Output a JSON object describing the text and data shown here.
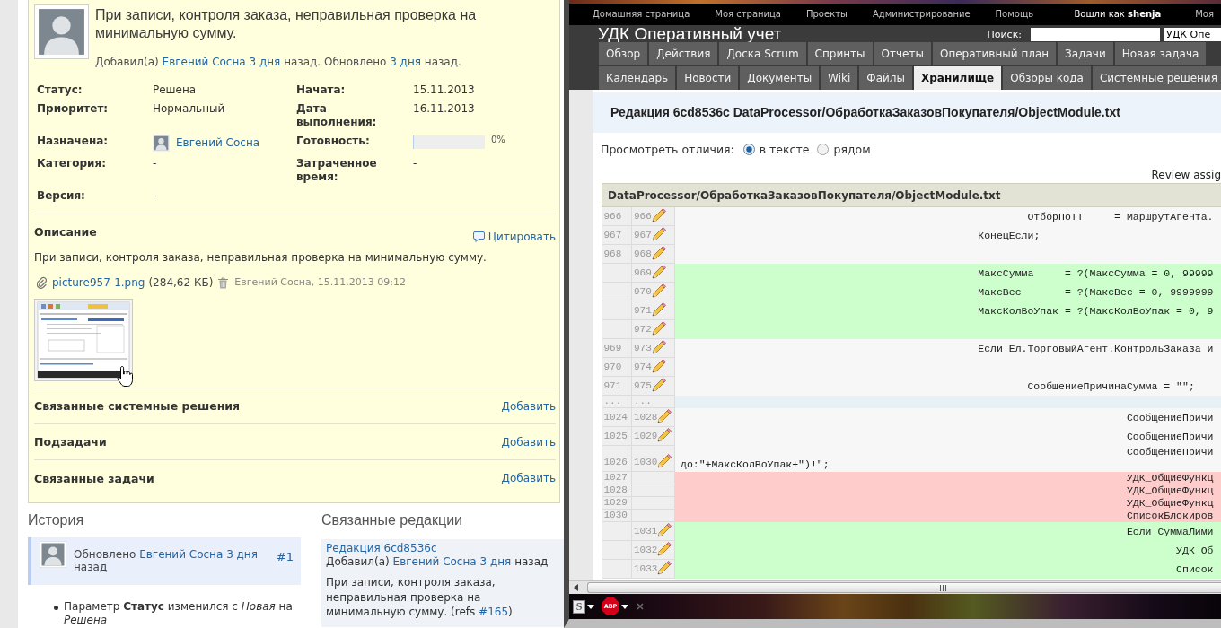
{
  "issue": {
    "subject": "При записи, контроля заказа, неправильная проверка на минимальную сумму.",
    "byline": [
      {
        "kind": "text",
        "text": "Добавил(а) "
      },
      {
        "kind": "user",
        "text": "Евгений Сосна"
      },
      {
        "kind": "time",
        "text": "3 дня"
      },
      {
        "kind": "text",
        "text": " назад. Обновлено "
      },
      {
        "kind": "time",
        "text": "3 дня"
      },
      {
        "kind": "text",
        "text": " назад."
      }
    ],
    "attributes": [
      {
        "left": {
          "label": "Статус:",
          "kind": "text",
          "value": "Решена"
        },
        "right": {
          "label": "Начата:",
          "kind": "text",
          "value": "15.11.2013"
        }
      },
      {
        "left": {
          "label": "Приоритет:",
          "kind": "text",
          "value": "Нормальный"
        },
        "right": {
          "label": "Дата выполнения:",
          "kind": "text",
          "value": "16.11.2013"
        }
      },
      {
        "left": {
          "label": "Назначена:",
          "kind": "user",
          "value": "Евгений Сосна"
        },
        "right": {
          "label": "Готовность:",
          "kind": "progress",
          "level": 0,
          "value": "0%"
        }
      },
      {
        "left": {
          "label": "Категория:",
          "kind": "text",
          "value": "-"
        },
        "right": {
          "label": "Затраченное время:",
          "kind": "text",
          "value": "-"
        }
      },
      {
        "left": {
          "label": "Версия:",
          "kind": "text",
          "value": "-"
        }
      }
    ],
    "description": {
      "title": "Описание",
      "quote_link": "Цитировать",
      "text": "При записи, контроля заказа, неправильная проверка на минимальную сумму."
    },
    "attachment": {
      "filename": "picture957-1.png",
      "size": "(284,62 КБ)",
      "author_date": "Евгений Сосна, 15.11.2013 09:12"
    },
    "relations": [
      {
        "title": "Связанные системные решения",
        "action": "Добавить"
      },
      {
        "title": "Подзадачи",
        "action": "Добавить"
      },
      {
        "title": "Связанные задачи",
        "action": "Добавить"
      }
    ]
  },
  "history": {
    "title": "История",
    "entries": [
      {
        "header": [
          {
            "kind": "text",
            "text": "Обновлено "
          },
          {
            "kind": "user",
            "text": "Евгений Сосна"
          },
          {
            "kind": "time",
            "text": "3 дня"
          },
          {
            "kind": "text",
            "text": " назад"
          }
        ],
        "number": "#1",
        "details": [
          "Параметр **Статус** изменился с *Новая* на *Решена*"
        ]
      }
    ]
  },
  "related_revisions": {
    "title": "Связанные редакции",
    "items": [
      {
        "revision": "Редакция 6cd8536c",
        "byline": [
          {
            "kind": "text",
            "text": "Добавил(а) "
          },
          {
            "kind": "user",
            "text": "Евгений Сосна"
          },
          {
            "kind": "time",
            "text": "3 дня"
          },
          {
            "kind": "text",
            "text": " назад"
          }
        ],
        "message": [
          {
            "kind": "text",
            "text": "При записи, контроля заказа, неправильная проверка на минимальную сумму. (refs "
          },
          {
            "kind": "ref",
            "text": "#165"
          },
          {
            "kind": "text",
            "text": ")"
          }
        ]
      }
    ]
  },
  "repository_window": {
    "top_menu": [
      "Домашняя страница",
      "Моя страница",
      "Проекты",
      "Администрирование",
      "Помощь"
    ],
    "account": {
      "logged_in": "Вошли как **shenja**",
      "menu": "Моя"
    },
    "project_title": "УДК Оперативный учет",
    "search": {
      "label": "Поиск:",
      "project": "УДК Опе"
    },
    "tab_rows": [
      [
        {
          "label": "Обзор",
          "selected": false
        },
        {
          "label": "Действия",
          "selected": false
        },
        {
          "label": "Доска Scrum",
          "selected": false
        },
        {
          "label": "Спринты",
          "selected": false
        },
        {
          "label": "Отчеты",
          "selected": false
        },
        {
          "label": "Оперативный план",
          "selected": false
        },
        {
          "label": "Задачи",
          "selected": false
        },
        {
          "label": "Новая задача",
          "selected": false
        }
      ],
      [
        {
          "label": "Календарь",
          "selected": false
        },
        {
          "label": "Новости",
          "selected": false
        },
        {
          "label": "Документы",
          "selected": false
        },
        {
          "label": "Wiki",
          "selected": false
        },
        {
          "label": "Файлы",
          "selected": false
        },
        {
          "label": "Хранилище",
          "selected": true
        },
        {
          "label": "Обзоры кода",
          "selected": false
        },
        {
          "label": "Системные решения",
          "selected": false
        }
      ]
    ],
    "revision_title": "Редакция 6cd8536c DataProcessor/ОбработкаЗаказовПокупателя/ObjectModule.txt",
    "view_diff": {
      "label": "Просмотреть отличия:",
      "options": [
        {
          "label": "в тексте",
          "selected": true
        },
        {
          "label": "рядом",
          "selected": false
        }
      ]
    },
    "review_link": "Review assig",
    "diff": {
      "file": "DataProcessor/ОбработкаЗаказовПокупателя/ObjectModule.txt",
      "rows": [
        {
          "kind": "context",
          "old": "966",
          "new": "966",
          "code": [
            "\t\t\t\t\t\t\tОтборПоТТ     = МаршрутАгента."
          ]
        },
        {
          "kind": "context",
          "old": "967",
          "new": "967",
          "code": [
            "\t\t\t\t\t\tКонецЕсли;"
          ]
        },
        {
          "kind": "context",
          "old": "968",
          "new": "968"
        },
        {
          "kind": "added",
          "new": "969",
          "code": [
            "\t\t\t\t\t\tМаксСумма     = ?(МаксСумма = 0, 99999"
          ]
        },
        {
          "kind": "added",
          "new": "970",
          "code": [
            "\t\t\t\t\t\tМаксВес       = ?(МаксВес = 0, 9999999"
          ]
        },
        {
          "kind": "added",
          "new": "971",
          "code": [
            "\t\t\t\t\t\tМаксКолВоУпак = ?(МаксКолВоУпак = 0, 9"
          ]
        },
        {
          "kind": "added",
          "new": "972"
        },
        {
          "kind": "context",
          "old": "969",
          "new": "973",
          "code": [
            "\t\t\t\t\t\tЕсли Ел.ТорговыйАгент.КонтрольЗаказа и"
          ]
        },
        {
          "kind": "context",
          "old": "970",
          "new": "974"
        },
        {
          "kind": "context",
          "old": "971",
          "new": "975",
          "code": [
            "\t\t\t\t\t\t\tСообщениеПричинаСумма = \"\";"
          ]
        },
        {
          "kind": "separator",
          "old": "...",
          "new": "..."
        },
        {
          "kind": "context",
          "old": "1024",
          "new": "1028",
          "code": [
            "\t\t\t\t\t\t\t\t\tСообщениеПричи"
          ]
        },
        {
          "kind": "context",
          "old": "1025",
          "new": "1029",
          "code": [
            "\t\t\t\t\t\t\t\t\tСообщениеПричи"
          ]
        },
        {
          "kind": "context",
          "old": "1026",
          "new": "1030",
          "code": [
            "\t\t\t\t\t\t\t\t\tСообщениеПричи",
            "до:\"+МаксКолВоУпак+\")!\";"
          ]
        },
        {
          "kind": "removed",
          "old": "1027",
          "code": [
            "\t\t\t\t\t\t\t\t\tУДК_ОбщиеФункц"
          ]
        },
        {
          "kind": "removed",
          "old": "1028",
          "code": [
            "\t\t\t\t\t\t\t\t\tУДК_ОбщиеФункц"
          ]
        },
        {
          "kind": "removed",
          "old": "1029",
          "code": [
            "\t\t\t\t\t\t\t\t\tУДК_ОбщиеФункц"
          ]
        },
        {
          "kind": "removed",
          "old": "1030",
          "code": [
            "\t\t\t\t\t\t\t\t\tСписокБлокиров"
          ]
        },
        {
          "kind": "added",
          "new": "1031",
          "code": [
            "\t\t\t\t\t\t\t\t\tЕсли СуммаЛими"
          ]
        },
        {
          "kind": "added",
          "new": "1032",
          "code": [
            "\t\t\t\t\t\t\t\t\t\tУДК_Об"
          ]
        },
        {
          "kind": "added",
          "new": "1033",
          "code": [
            "\t\t\t\t\t\t\t\t\t\tСписок"
          ]
        }
      ]
    },
    "addons": [
      {
        "kind": "letter",
        "label": "S"
      },
      {
        "kind": "octagon",
        "label": "ABP"
      }
    ]
  }
}
